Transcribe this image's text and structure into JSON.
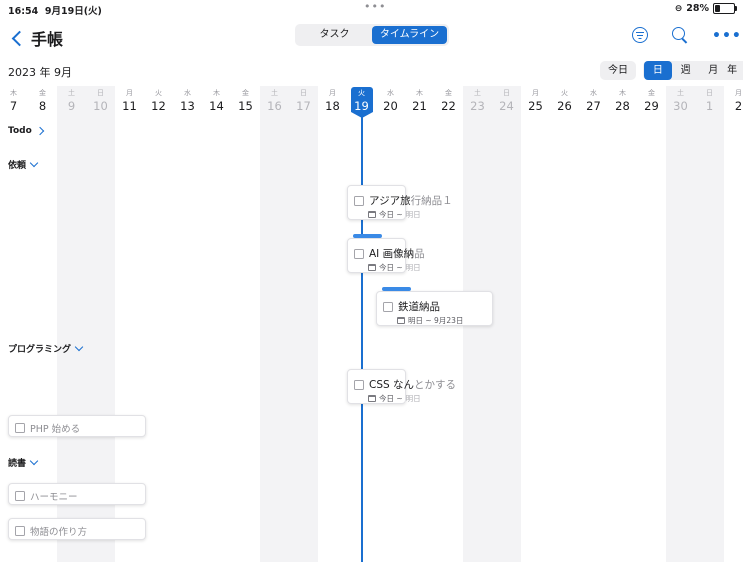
{
  "status": {
    "time": "16:54",
    "date": "9月19日(火)",
    "dots": "•••",
    "battery": "28%",
    "battery_level": 0.28
  },
  "nav": {
    "title": "手帳",
    "tabs": [
      {
        "label": "タスク",
        "active": false
      },
      {
        "label": "タイムライン",
        "active": true
      }
    ],
    "more": "•••"
  },
  "toolbar": {
    "month": "2023 年 9月",
    "today_label": "今日",
    "ranges": [
      {
        "label": "日",
        "active": true
      },
      {
        "label": "週",
        "active": false
      },
      {
        "label": "月",
        "active": false
      },
      {
        "label": "年",
        "active": false
      }
    ]
  },
  "days": [
    {
      "wd": "木",
      "d": "7"
    },
    {
      "wd": "金",
      "d": "8"
    },
    {
      "wd": "土",
      "d": "9"
    },
    {
      "wd": "日",
      "d": "10"
    },
    {
      "wd": "月",
      "d": "11"
    },
    {
      "wd": "火",
      "d": "12"
    },
    {
      "wd": "水",
      "d": "13"
    },
    {
      "wd": "木",
      "d": "14"
    },
    {
      "wd": "金",
      "d": "15"
    },
    {
      "wd": "土",
      "d": "16"
    },
    {
      "wd": "日",
      "d": "17"
    },
    {
      "wd": "月",
      "d": "18"
    },
    {
      "wd": "火",
      "d": "19"
    },
    {
      "wd": "水",
      "d": "20"
    },
    {
      "wd": "木",
      "d": "21"
    },
    {
      "wd": "金",
      "d": "22"
    },
    {
      "wd": "土",
      "d": "23"
    },
    {
      "wd": "日",
      "d": "24"
    },
    {
      "wd": "月",
      "d": "25"
    },
    {
      "wd": "火",
      "d": "26"
    },
    {
      "wd": "水",
      "d": "27"
    },
    {
      "wd": "木",
      "d": "28"
    },
    {
      "wd": "金",
      "d": "29"
    },
    {
      "wd": "土",
      "d": "30"
    },
    {
      "wd": "日",
      "d": "1"
    },
    {
      "wd": "月",
      "d": "2"
    }
  ],
  "groups": {
    "todo": "Todo",
    "irai": "依頼",
    "programming": "プログラミング",
    "dokusho": "読書"
  },
  "tasks": {
    "asia": {
      "title_a": "アジア旅",
      "title_b": "行納品１",
      "date_a": "今日 ~",
      "date_b": "明日"
    },
    "ai": {
      "title_a": "AI 画像納",
      "title_b": "品",
      "date_a": "今日 ~",
      "date_b": "明日"
    },
    "tetsudo": {
      "title": "鉄道納品",
      "date": "明日 ~ 9月23日"
    },
    "css": {
      "title_a": "CSS なん",
      "title_b": "とかする",
      "date_a": "今日 ~",
      "date_b": "明日"
    },
    "php": {
      "title": "PHP 始める"
    },
    "harmony": {
      "title": "ハーモニー"
    },
    "monogatari": {
      "title": "物語の作り方"
    }
  },
  "colors": {
    "accent": "#1a6fd0",
    "bar": "#3a8ae6"
  }
}
